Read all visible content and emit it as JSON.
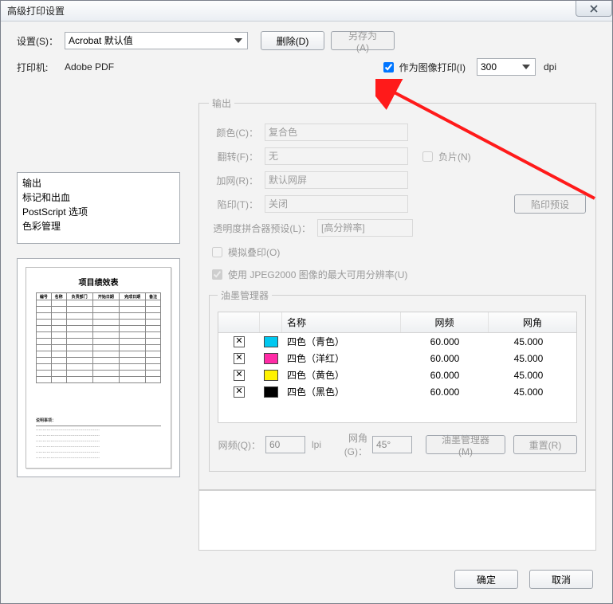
{
  "title": "高级打印设置",
  "settings": {
    "label": "设置(S)：",
    "value": "Acrobat 默认值"
  },
  "delete_btn": "删除(D)",
  "saveas_btn": "另存为(A)",
  "printer": {
    "label": "打印机:",
    "value": "Adobe PDF"
  },
  "print_as_image": {
    "label": "作为图像打印(I)",
    "checked": true
  },
  "dpi": {
    "value": "300",
    "unit": "dpi"
  },
  "nav": {
    "items": [
      "输出",
      "标记和出血",
      "PostScript 选项",
      "色彩管理"
    ]
  },
  "output": {
    "legend": "输出",
    "color": {
      "label": "颜色(C)：",
      "value": "复合色"
    },
    "flip": {
      "label": "翻转(F)：",
      "value": "无"
    },
    "negative": {
      "label": "负片(N)",
      "checked": false
    },
    "screen": {
      "label": "加网(R)：",
      "value": "默认网屏"
    },
    "trap": {
      "label": "陷印(T)：",
      "value": "关闭",
      "preset_btn": "陷印预设"
    },
    "flattener": {
      "label": "透明度拼合器预设(L)：",
      "value": "[高分辨率]"
    },
    "simulate_overprint": {
      "label": "模拟叠印(O)",
      "checked": false
    },
    "use_jpeg2000": {
      "label": "使用 JPEG2000 图像的最大可用分辨率(U)",
      "checked": true
    },
    "ink_mgr": {
      "legend": "油墨管理器",
      "headers": {
        "name": "名称",
        "freq": "网频",
        "angle": "网角"
      },
      "rows": [
        {
          "color": "#00C8F0",
          "name": "四色（青色）",
          "freq": "60.000",
          "angle": "45.000"
        },
        {
          "color": "#FF2BA6",
          "name": "四色（洋红）",
          "freq": "60.000",
          "angle": "45.000"
        },
        {
          "color": "#FFF200",
          "name": "四色（黄色）",
          "freq": "60.000",
          "angle": "45.000"
        },
        {
          "color": "#000000",
          "name": "四色（黑色）",
          "freq": "60.000",
          "angle": "45.000"
        }
      ]
    },
    "freq": {
      "label": "网频(Q)：",
      "value": "60",
      "unit": "lpi"
    },
    "angle": {
      "label": "网角(G)：",
      "value": "45°"
    },
    "ink_mgr_btn": "油墨管理器(M)",
    "reset_btn": "重置(R)"
  },
  "dialog": {
    "ok": "确定",
    "cancel": "取消"
  },
  "preview": {
    "title": "项目绩效表",
    "headers": [
      "编号",
      "名称",
      "负责部门",
      "开始日期",
      "完成日期",
      "备注"
    ]
  }
}
